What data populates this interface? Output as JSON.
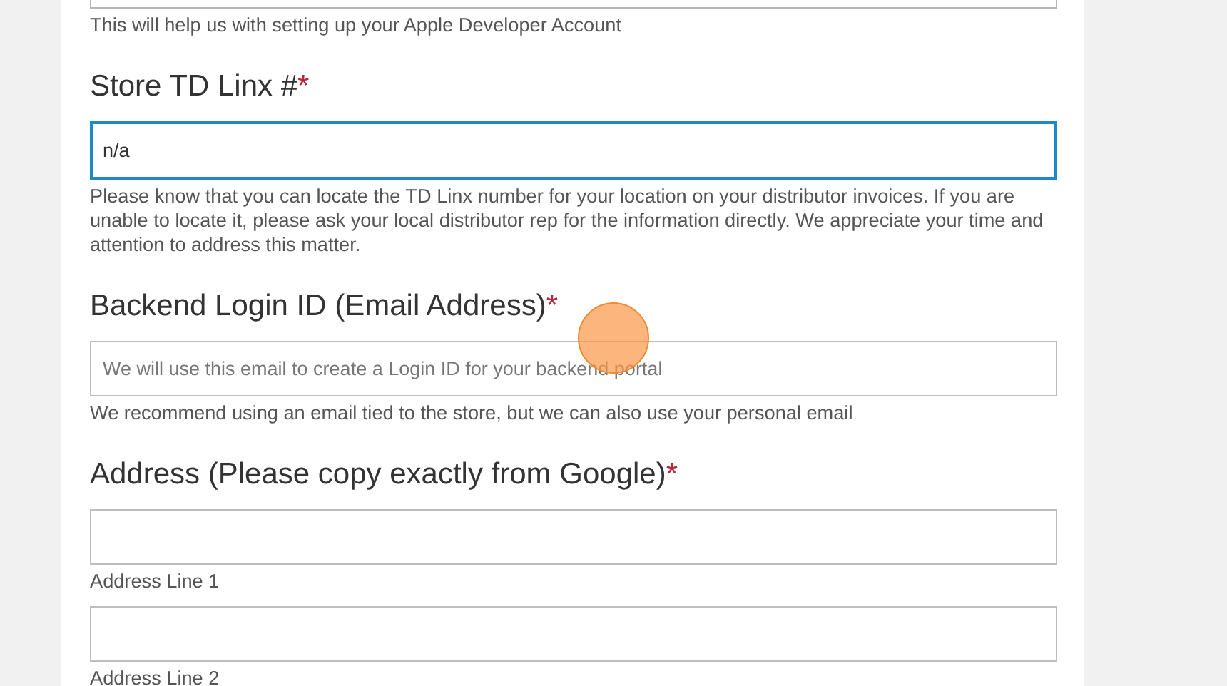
{
  "form": {
    "previous_field": {
      "help": "This will help us with setting up your Apple Developer Account"
    },
    "fields": [
      {
        "kind": "text",
        "label": "Store TD Linx #",
        "required_mark": "*",
        "value": "n/a",
        "focused": true,
        "help": "Please know that you can locate the TD Linx number for your location on your distributor invoices. If you are unable to locate it, please ask your local distributor rep for the information directly. We appreciate your time and attention to address this matter."
      },
      {
        "kind": "text",
        "label": "Backend Login ID (Email Address)",
        "required_mark": "*",
        "placeholder": "We will use this email to create a Login ID for your backend portal",
        "focused": false,
        "help": "We recommend using an email tied to the store, but we can also use your personal email"
      },
      {
        "kind": "address",
        "label": "Address (Please copy exactly from Google)",
        "required_mark": "*",
        "lines": [
          {
            "sublabel": "Address Line 1",
            "focused": false
          },
          {
            "sublabel": "Address Line 2",
            "focused": false
          }
        ]
      }
    ]
  }
}
